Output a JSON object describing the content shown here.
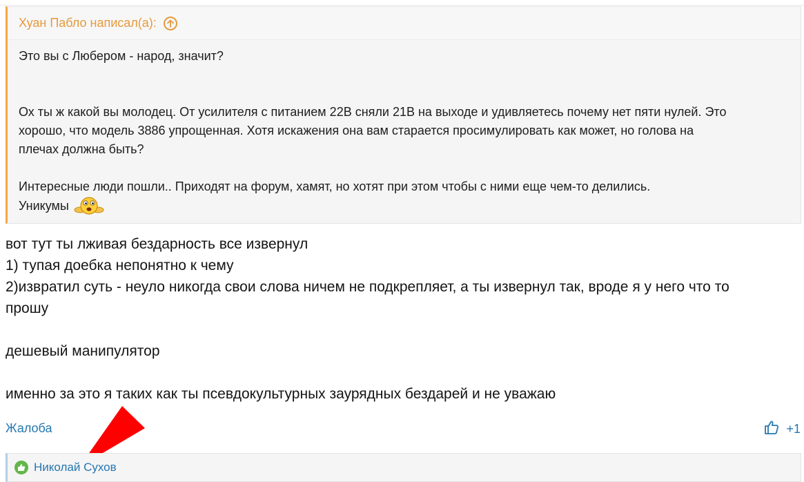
{
  "quote": {
    "author": "Хуан Пабло написал(а):",
    "line1": "Это вы с Любером - народ, значит?",
    "line2": "Ох ты ж какой вы молодец. От усилителя с питанием 22В сняли 21В на выходе и удивляетесь почему нет пяти нулей. Это",
    "line3": "хорошо, что модель 3886 упрощенная. Хотя искажения она вам старается просимулировать как может, но голова на",
    "line4": "плечах должна быть?",
    "line5": "Интересные люди пошли.. Приходят на форум, хамят, но хотят при этом чтобы с ними еще чем-то делились.",
    "line6": "Уникумы",
    "accent_color": "#f7a642"
  },
  "post": {
    "line1": "вот тут ты лживая бездарность все извернул",
    "line2": "1) тупая доебка непонятно к чему",
    "line3": "2)извратил суть - неуло никогда свои слова ничем не подкрепляет, а ты извернул так, вроде я у него что то",
    "line4": "прошу",
    "line5": "дешевый манипулятор",
    "line6": "именно за это я таких как ты псевдокультурных заурядных бездарей и не уважаю"
  },
  "actions": {
    "report_label": "Жалоба",
    "like_count": "+1",
    "link_color": "#2577b1"
  },
  "reactions": {
    "user": "Николай Сухов",
    "icon_color": "#63b648"
  },
  "icons": {
    "quote_up": "arrow-up-circle-icon",
    "smiley": "smiley-emoticon-icon",
    "like": "thumbs-up-icon",
    "reaction": "thumbs-up-reaction-icon",
    "annotation": "red-pointer-triangle"
  }
}
